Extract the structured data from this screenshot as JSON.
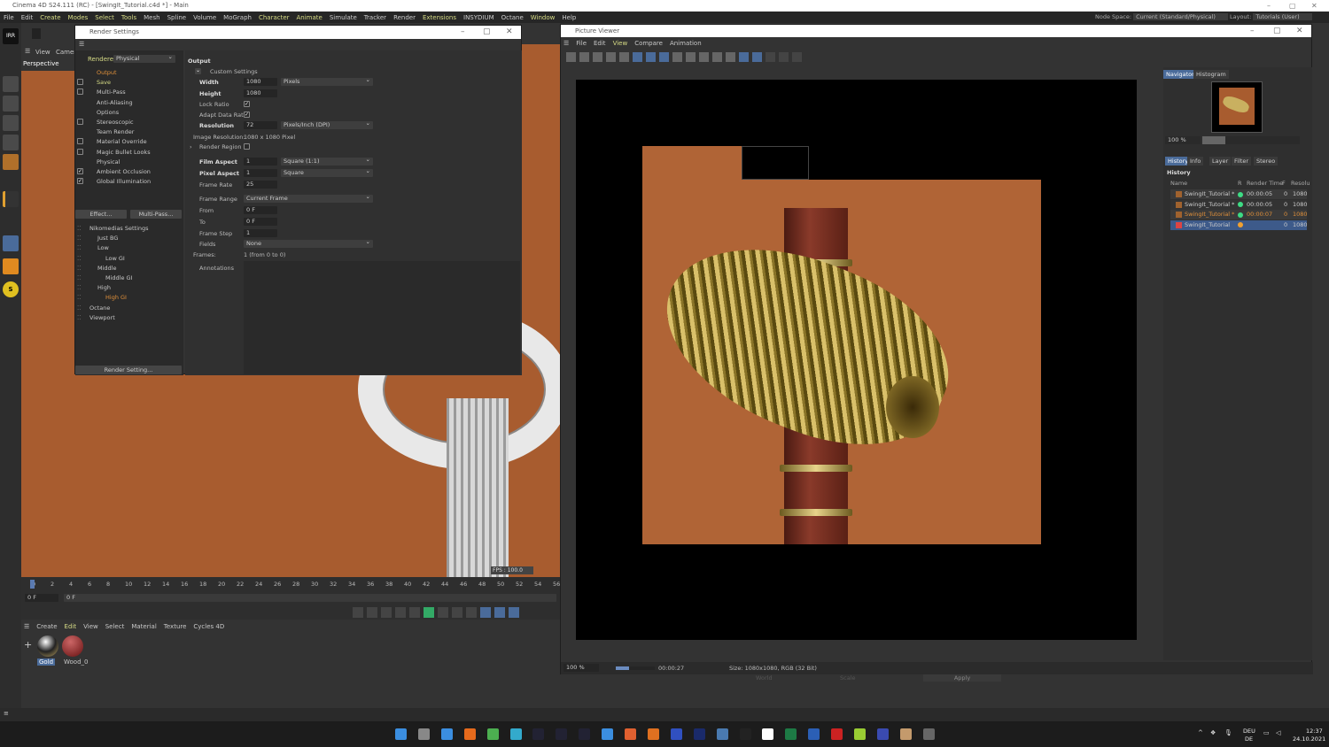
{
  "app": {
    "title": "Cinema 4D S24.111 (RC) - [SwingIt_Tutorial.c4d *] - Main",
    "menu": [
      "File",
      "Edit",
      "Create",
      "Modes",
      "Select",
      "Tools",
      "Mesh",
      "Spline",
      "Volume",
      "MoGraph",
      "Character",
      "Animate",
      "Simulate",
      "Tracker",
      "Render",
      "Extensions",
      "INSYDIUM",
      "Octane",
      "Window",
      "Help"
    ],
    "highlighted_menus": [
      "Create",
      "Modes",
      "Select",
      "Tools",
      "Character",
      "Animate",
      "Extensions",
      "Window"
    ],
    "node_space_label": "Node Space:",
    "node_space_value": "Current (Standard/Physical)",
    "layout_label": "Layout:",
    "layout_value": "Tutorials (User)"
  },
  "viewport": {
    "menu": [
      "View",
      "Camera"
    ],
    "camera": "Perspective",
    "fps": "FPS : 100.0"
  },
  "render_settings": {
    "title": "Render Settings",
    "renderer_label": "Renderer",
    "renderer_value": "Physical",
    "items": [
      {
        "label": "Output",
        "checkbox": null,
        "active": true
      },
      {
        "label": "Save",
        "checkbox": false
      },
      {
        "label": "Multi-Pass",
        "checkbox": false
      },
      {
        "label": "Anti-Aliasing",
        "checkbox": null
      },
      {
        "label": "Options",
        "checkbox": null
      },
      {
        "label": "Stereoscopic",
        "checkbox": false
      },
      {
        "label": "Team Render",
        "checkbox": null
      },
      {
        "label": "Material Override",
        "checkbox": false
      },
      {
        "label": "Magic Bullet Looks",
        "checkbox": false
      },
      {
        "label": "Physical",
        "checkbox": null
      },
      {
        "label": "Ambient Occlusion",
        "checkbox": true
      },
      {
        "label": "Global Illumination",
        "checkbox": true
      }
    ],
    "effect_button": "Effect...",
    "multipass_button": "Multi-Pass...",
    "presets": [
      {
        "label": "Nikomedias Settings",
        "indent": 0
      },
      {
        "label": "Just BG",
        "indent": 1
      },
      {
        "label": "Low",
        "indent": 1
      },
      {
        "label": "Low GI",
        "indent": 2
      },
      {
        "label": "Middle",
        "indent": 1
      },
      {
        "label": "Middle GI",
        "indent": 2
      },
      {
        "label": "High",
        "indent": 1
      },
      {
        "label": "High GI",
        "indent": 2,
        "active": true
      },
      {
        "label": "Octane",
        "indent": 0
      },
      {
        "label": "Viewport",
        "indent": 0
      }
    ],
    "render_setting_button": "Render Setting...",
    "output": {
      "heading": "Output",
      "custom_settings": "Custom Settings",
      "width_label": "Width",
      "width": "1080",
      "width_unit": "Pixels",
      "height_label": "Height",
      "height": "1080",
      "lock_ratio_label": "Lock Ratio",
      "lock_ratio": true,
      "adapt_label": "Adapt Data Rate",
      "adapt": true,
      "resolution_label": "Resolution",
      "resolution": "72",
      "resolution_unit": "Pixels/Inch (DPI)",
      "image_res_label": "Image Resolution:",
      "image_res": "1080 x 1080 Pixel",
      "render_region_label": "Render Region",
      "render_region": false,
      "film_aspect_label": "Film Aspect",
      "film_aspect": "1",
      "film_aspect_preset": "Square (1:1)",
      "pixel_aspect_label": "Pixel Aspect",
      "pixel_aspect": "1",
      "pixel_aspect_preset": "Square",
      "frame_rate_label": "Frame Rate",
      "frame_rate": "25",
      "frame_range_label": "Frame Range",
      "frame_range": "Current Frame",
      "from_label": "From",
      "from": "0 F",
      "to_label": "To",
      "to": "0 F",
      "frame_step_label": "Frame Step",
      "frame_step": "1",
      "fields_label": "Fields",
      "fields": "None",
      "frames_label": "Frames:",
      "frames": "1 (from 0 to 0)",
      "annotations_label": "Annotations"
    }
  },
  "picture_viewer": {
    "title": "Picture Viewer",
    "menu": [
      "File",
      "Edit",
      "View",
      "Compare",
      "Animation"
    ],
    "side_tabs": [
      "Navigator",
      "Histogram"
    ],
    "zoom": "100 %",
    "history_tabs": [
      "History",
      "Info",
      "Layer",
      "Filter",
      "Stereo"
    ],
    "history_heading": "History",
    "columns": [
      "Name",
      "R",
      "Render Time",
      "F",
      "Resolu"
    ],
    "rows": [
      {
        "name": "SwingIt_Tutorial *",
        "status": "#3ddc84",
        "time": "00:00:05",
        "f": "0",
        "res": "1080"
      },
      {
        "name": "SwingIt_Tutorial *",
        "status": "#3ddc84",
        "time": "00:00:05",
        "f": "0",
        "res": "1080"
      },
      {
        "name": "SwingIt_Tutorial *",
        "status": "#3ddc84",
        "time": "00:00:07",
        "f": "0",
        "res": "1080",
        "highlight": true
      },
      {
        "name": "SwingIt_Tutorial",
        "status": "#f0a030",
        "time": "",
        "f": "0",
        "res": "1080",
        "selected": true
      }
    ],
    "status_zoom": "100 %",
    "status_time": "00:00:27",
    "status_size": "Size: 1080x1080, RGB (32 Bit)",
    "progress": 0.35,
    "behind": {
      "world": "World",
      "scale": "Scale",
      "apply": "Apply"
    }
  },
  "timeline": {
    "ticks": [
      "0",
      "2",
      "4",
      "6",
      "8",
      "10",
      "12",
      "14",
      "16",
      "18",
      "20",
      "22",
      "24",
      "26",
      "28",
      "30",
      "32",
      "34",
      "36",
      "38",
      "40",
      "42",
      "44",
      "46",
      "48",
      "50",
      "52",
      "54",
      "56"
    ],
    "current": "0 F",
    "end": "0 F"
  },
  "material_manager": {
    "menu": [
      "Create",
      "Edit",
      "View",
      "Select",
      "Material",
      "Texture",
      "Cycles 4D"
    ],
    "materials": [
      {
        "name": "Gold",
        "selected": true
      },
      {
        "name": "Wood_0"
      }
    ]
  },
  "taskbar": {
    "lang1": "DEU",
    "lang2": "DE",
    "time": "12:37",
    "date": "24.10.2021"
  }
}
